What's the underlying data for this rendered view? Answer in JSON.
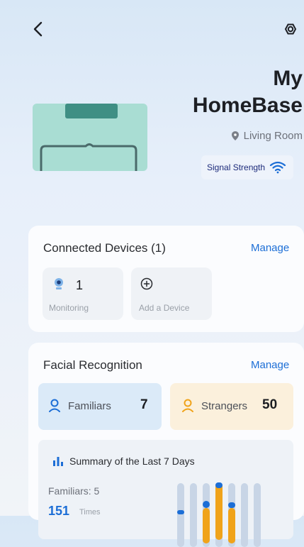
{
  "header": {
    "title_line1": "My",
    "title_line2": "HomeBase",
    "location": "Living Room",
    "signal_label": "Signal Strength"
  },
  "connected_devices": {
    "title": "Connected Devices (1)",
    "manage_label": "Manage",
    "monitoring_count": "1",
    "monitoring_label": "Monitoring",
    "add_device_label": "Add a Device"
  },
  "facial_recognition": {
    "title": "Facial Recognition",
    "manage_label": "Manage",
    "familiars_label": "Familiars",
    "familiars_count": "7",
    "strangers_label": "Strangers",
    "strangers_count": "50"
  },
  "summary": {
    "title": "Summary of the Last 7 Days",
    "familiars_label": "Familiars: 5",
    "total_count": "151",
    "total_unit": "Times"
  },
  "colors": {
    "accent": "#1c6ed6",
    "familiar_bg": "#dbeaf8",
    "stranger_bg": "#fbf0dc",
    "stranger_accent": "#f0a31a",
    "device_teal": "#a9ddd3"
  },
  "icons": {
    "back": "chevron-left-icon",
    "settings": "gear-icon",
    "location": "location-pin-icon",
    "signal": "wifi-icon",
    "camera": "camera-icon",
    "add": "plus-circle-icon",
    "familiar": "person-icon",
    "stranger": "person-icon",
    "chart": "bar-chart-icon"
  }
}
